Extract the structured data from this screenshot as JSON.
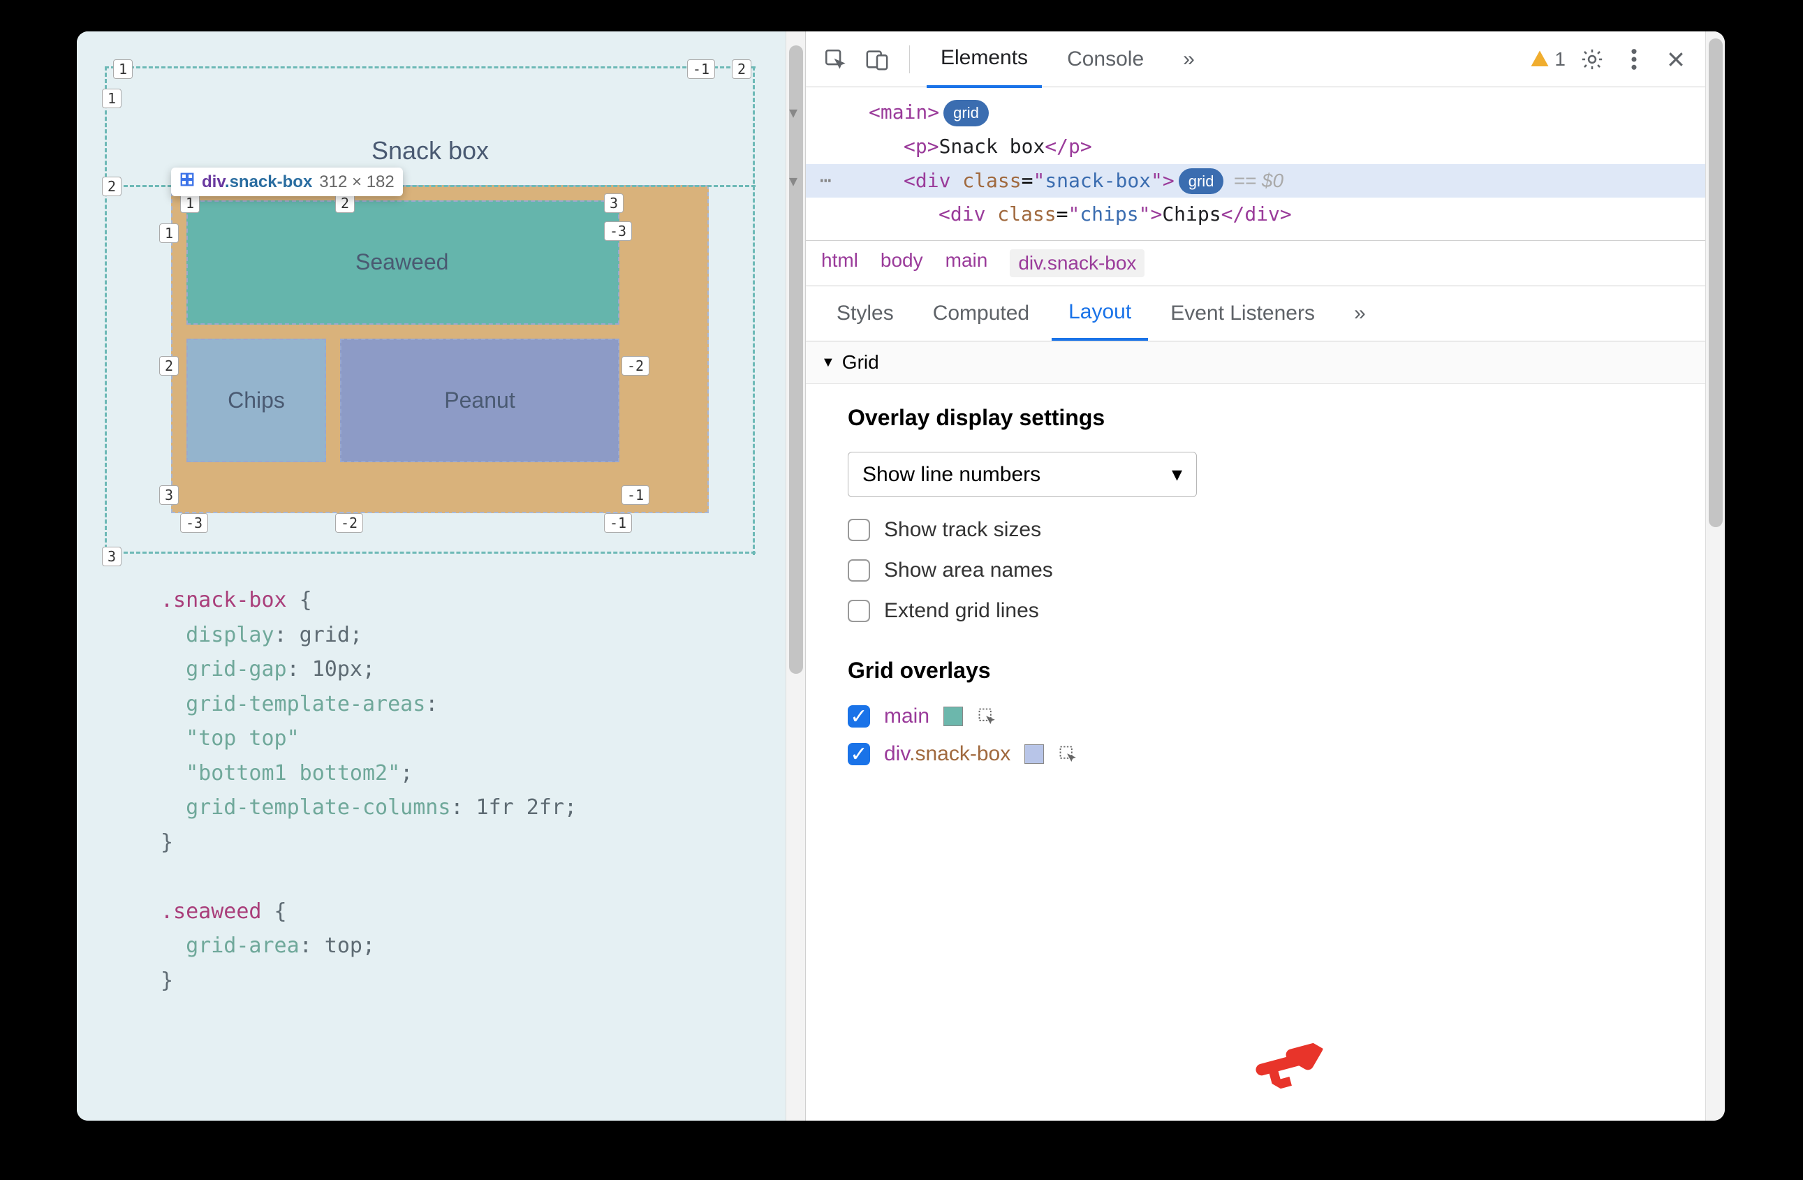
{
  "page": {
    "title": "Snack box",
    "cells": {
      "seaweed": "Seaweed",
      "chips": "Chips",
      "peanut": "Peanut"
    }
  },
  "tooltip": {
    "tag": "div",
    "class": ".snack-box",
    "dimensions": "312 × 182"
  },
  "outer_tracks": {
    "cols": [
      "1",
      "2",
      "-1"
    ],
    "rows": [
      "1",
      "2",
      "3"
    ]
  },
  "inner_tracks": {
    "cols_top": [
      "1",
      "2",
      "3"
    ],
    "cols_top_neg": [
      "-3",
      "-2",
      "-1"
    ],
    "rows_left": [
      "1",
      "2",
      "3"
    ],
    "rows_right_neg": [
      "-3",
      "-2",
      "-1"
    ]
  },
  "code": ".snack-box {\n  display: grid;\n  grid-gap: 10px;\n  grid-template-areas:\n  \"top top\"\n  \"bottom1 bottom2\";\n  grid-template-columns: 1fr 2fr;\n}\n\n.seaweed {\n  grid-area: top;\n}",
  "devtools": {
    "tabs": [
      "Elements",
      "Console"
    ],
    "active_tab": "Elements",
    "more": "»",
    "warning_count": "1",
    "dom": {
      "line1": {
        "tag": "main",
        "badge": "grid"
      },
      "line2": {
        "open": "<p>",
        "text": "Snack box",
        "close": "</p>"
      },
      "line3": {
        "tag": "div",
        "attr": "class",
        "val": "snack-box",
        "badge": "grid",
        "suffix": "== $0"
      },
      "line4": {
        "tag": "div",
        "attr": "class",
        "val": "chips",
        "text": "Chips",
        "close": "</div>"
      }
    },
    "breadcrumb": [
      "html",
      "body",
      "main",
      "div.snack-box"
    ],
    "subtabs": [
      "Styles",
      "Computed",
      "Layout",
      "Event Listeners"
    ],
    "active_subtab": "Layout",
    "grid_section": "Grid",
    "overlay_settings_title": "Overlay display settings",
    "select_value": "Show line numbers",
    "checks": [
      "Show track sizes",
      "Show area names",
      "Extend grid lines"
    ],
    "grid_overlays_title": "Grid overlays",
    "overlays": [
      {
        "name": "main",
        "class": "",
        "color": "#6cb7ac",
        "checked": true
      },
      {
        "name": "div",
        "class": ".snack-box",
        "color": "#b8c5e8",
        "checked": true
      }
    ]
  }
}
